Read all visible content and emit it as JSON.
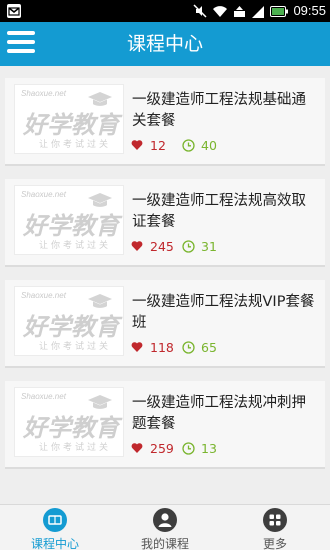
{
  "status": {
    "time": "09:55"
  },
  "header": {
    "title": "课程中心"
  },
  "courses": [
    {
      "title": "一级建造师工程法规基础通关套餐",
      "likes": "12",
      "hours": "40"
    },
    {
      "title": "一级建造师工程法规高效取证套餐",
      "likes": "245",
      "hours": "31"
    },
    {
      "title": "一级建造师工程法规VIP套餐班",
      "likes": "118",
      "hours": "65"
    },
    {
      "title": "一级建造师工程法规冲刺押题套餐",
      "likes": "259",
      "hours": "13"
    }
  ],
  "thumbnail": {
    "brand": "Shaoxue.net",
    "name": "好学教育",
    "slogan": "让你考试过关"
  },
  "tabs": [
    {
      "label": "课程中心",
      "icon": "book-icon",
      "active": true
    },
    {
      "label": "我的课程",
      "icon": "user-icon"
    },
    {
      "label": "更多",
      "icon": "grid-icon"
    }
  ],
  "colors": {
    "primary": "#149bd2",
    "like": "#c0282d",
    "hours": "#7ab52f"
  }
}
